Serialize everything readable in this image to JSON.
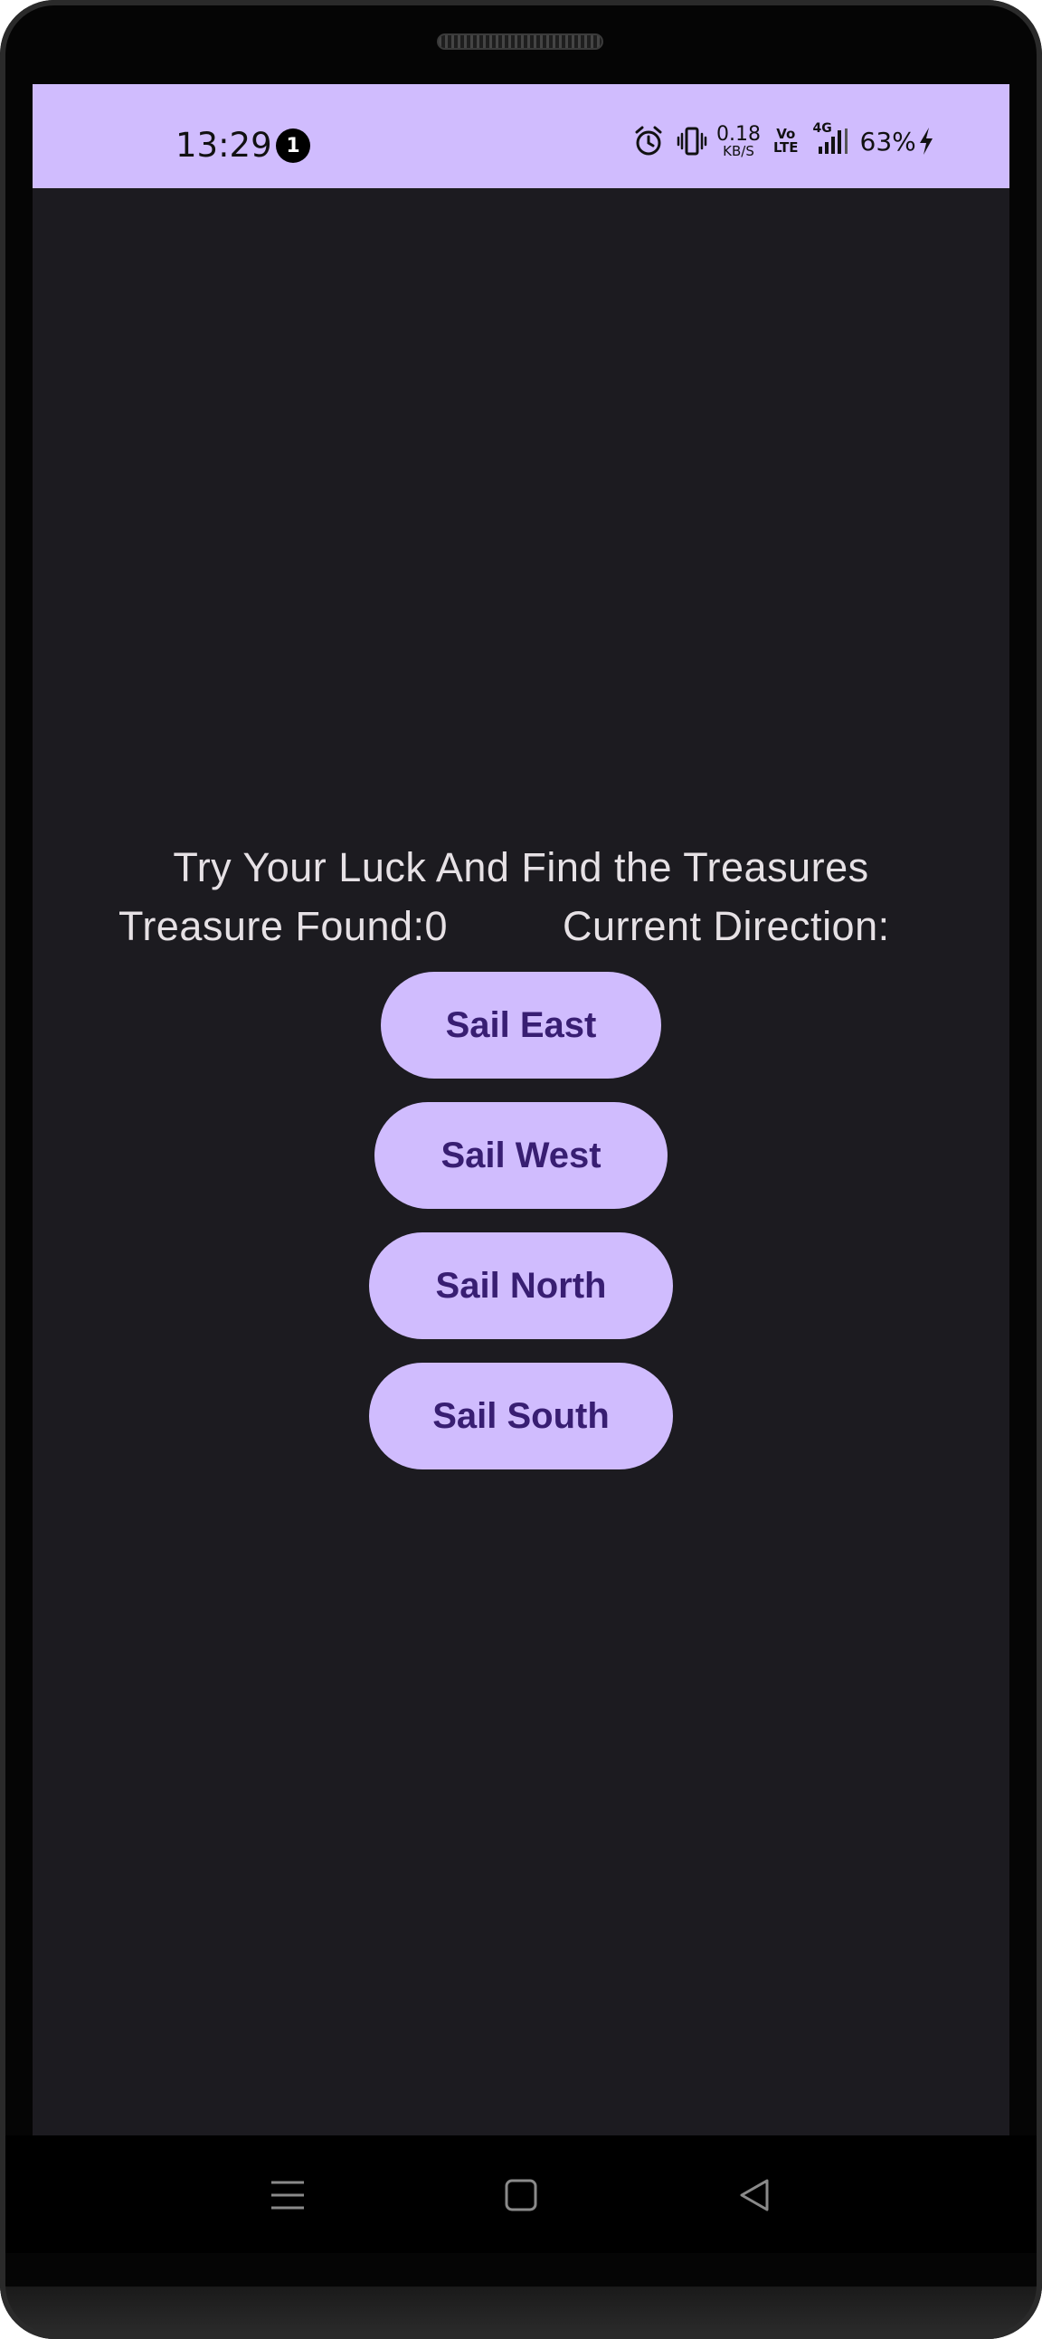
{
  "status_bar": {
    "time": "13:29",
    "notification_count": "1",
    "net_speed_value": "0.18",
    "net_speed_unit": "KB/S",
    "volte_top": "Vo",
    "volte_bottom": "LTE",
    "network_type": "4G",
    "battery": "63%",
    "icons": [
      "alarm-icon",
      "vibrate-icon",
      "signal-icon",
      "charging-icon"
    ]
  },
  "game": {
    "title": "Try Your Luck And Find the Treasures",
    "treasure_found": "Treasure Found:0",
    "current_direction": "Current Direction:"
  },
  "buttons": {
    "east": "Sail East",
    "west": "Sail West",
    "north": "Sail North",
    "south": "Sail South"
  },
  "nav": {
    "icons": [
      "menu-icon",
      "home-icon",
      "back-icon"
    ]
  },
  "colors": {
    "accent": "#d0bcfe",
    "button_text": "#381e72",
    "background": "#1c1b20",
    "text": "#e6e1e5"
  }
}
